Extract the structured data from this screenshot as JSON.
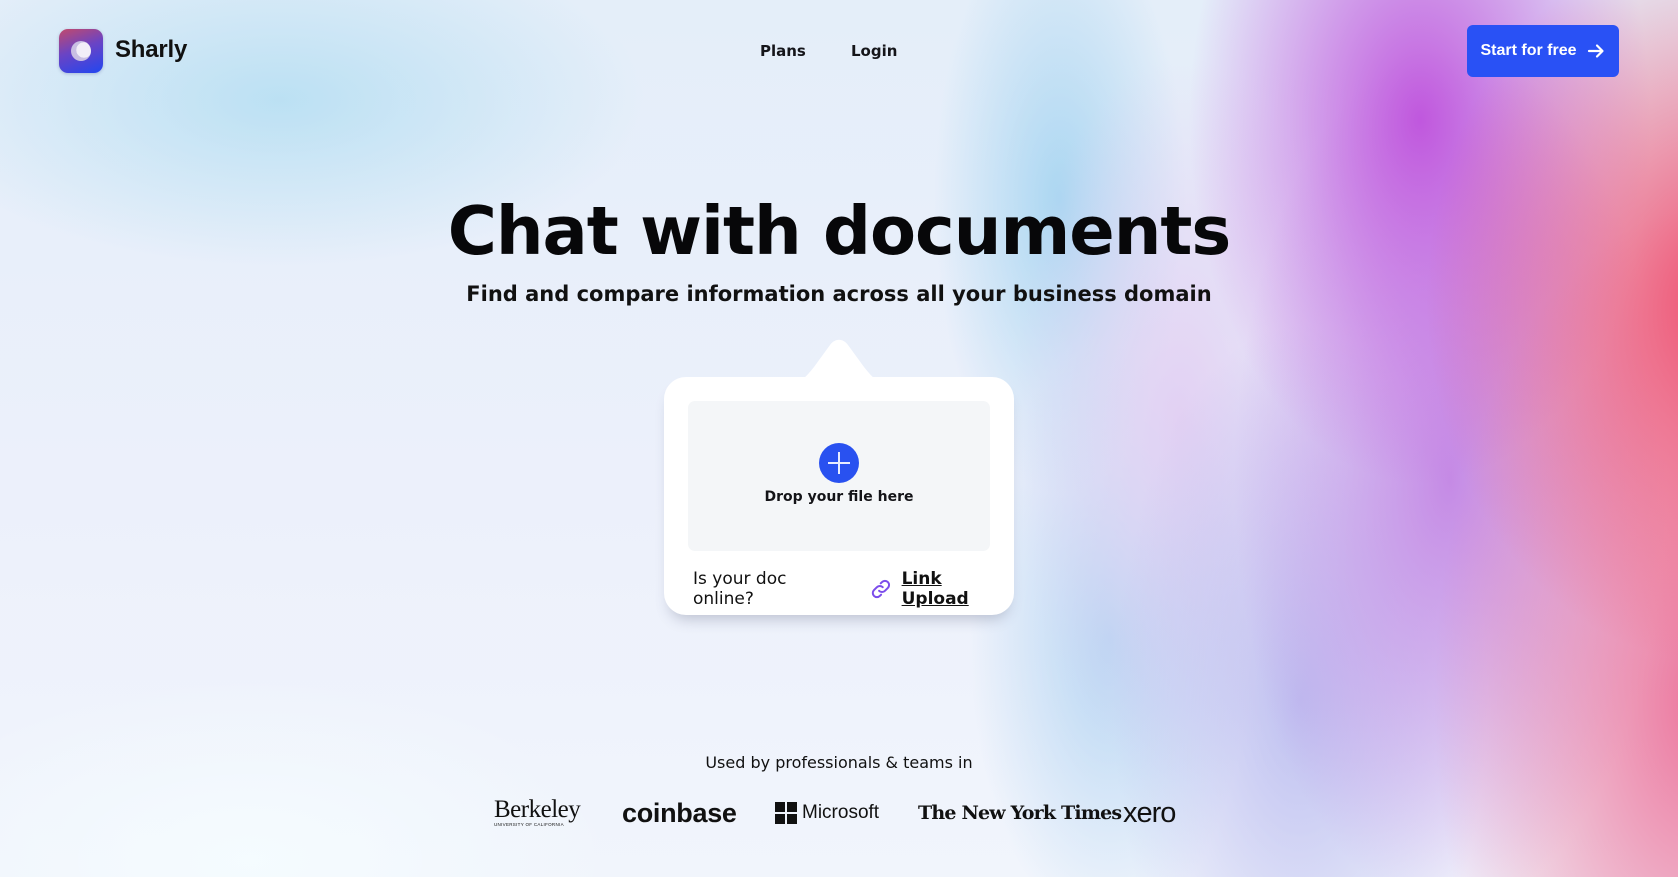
{
  "header": {
    "brand_name": "Sharly",
    "logo_icon": "sharly-orb-logo",
    "nav": [
      {
        "label": "Plans"
      },
      {
        "label": "Login"
      }
    ],
    "cta": {
      "label": "Start for free",
      "icon": "arrow-right-icon"
    }
  },
  "hero": {
    "title": "Chat with documents",
    "subtitle": "Find and compare information across all your business domain"
  },
  "upload": {
    "drop_icon": "plus-icon",
    "drop_label": "Drop your file here",
    "online_question": "Is your doc online?",
    "link_icon": "link-icon",
    "link_label": "Link Upload"
  },
  "trusted": {
    "heading": "Used by professionals & teams in",
    "logos": [
      {
        "name": "Berkeley",
        "subtitle": "UNIVERSITY OF CALIFORNIA"
      },
      {
        "name": "coinbase"
      },
      {
        "name": "Microsoft"
      },
      {
        "name": "The New York Times"
      },
      {
        "name": "xero"
      }
    ]
  },
  "colors": {
    "primary": "#2951F5",
    "link_icon": "#7C4DEB",
    "dropzone_bg": "#F4F6F8",
    "gradient_pink": "#F04868",
    "gradient_purple": "#BE50DC",
    "gradient_blue": "#A0D2F0"
  }
}
